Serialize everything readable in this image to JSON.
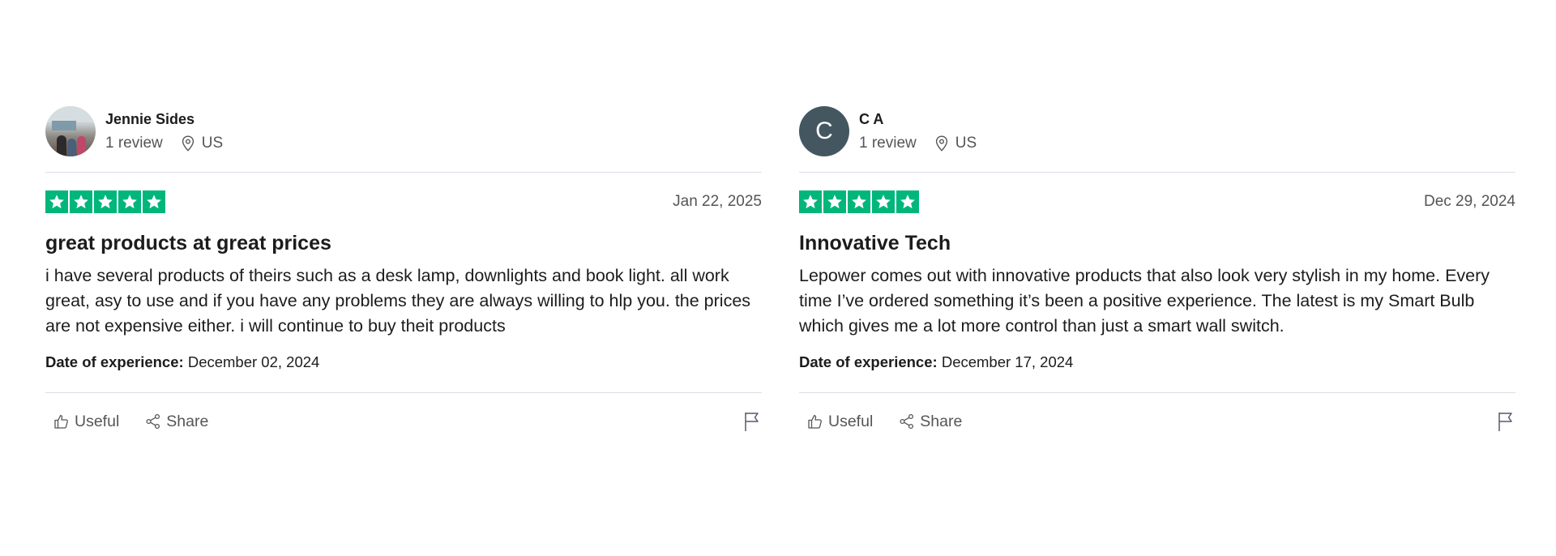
{
  "reviews": [
    {
      "consumer": {
        "name": "Jennie Sides",
        "reviews_count": "1 review",
        "country": "US",
        "avatar": "photo"
      },
      "rating": 5,
      "date": "Jan 22, 2025",
      "title": "great products at great prices",
      "text": "i have several products of theirs such as a desk lamp, downlights and book light. all work great, asy to use and if you have any problems they are always willing to hlp you. the prices are not expensive either. i will continue to buy theit products",
      "experience_label": "Date of experience:",
      "experience_date": "December 02, 2024",
      "actions": {
        "useful": "Useful",
        "share": "Share"
      }
    },
    {
      "consumer": {
        "name": "C A",
        "reviews_count": "1 review",
        "country": "US",
        "avatar_initial": "C",
        "avatar_color": "#445760"
      },
      "rating": 5,
      "date": "Dec 29, 2024",
      "title": "Innovative Tech",
      "text": "Lepower comes out with innovative products that also look very stylish in my home. Every time I’ve ordered something it’s been a positive experience. The latest is my Smart Bulb which gives me a lot more control than just a smart wall switch.",
      "experience_label": "Date of experience:",
      "experience_date": "December 17, 2024",
      "actions": {
        "useful": "Useful",
        "share": "Share"
      }
    }
  ],
  "colors": {
    "star_green": "#00b67a",
    "divider": "#dcdce6",
    "muted_text": "#555555"
  },
  "icons": [
    "location-pin-icon",
    "star-icon",
    "thumbs-up-icon",
    "share-icon",
    "flag-icon"
  ]
}
